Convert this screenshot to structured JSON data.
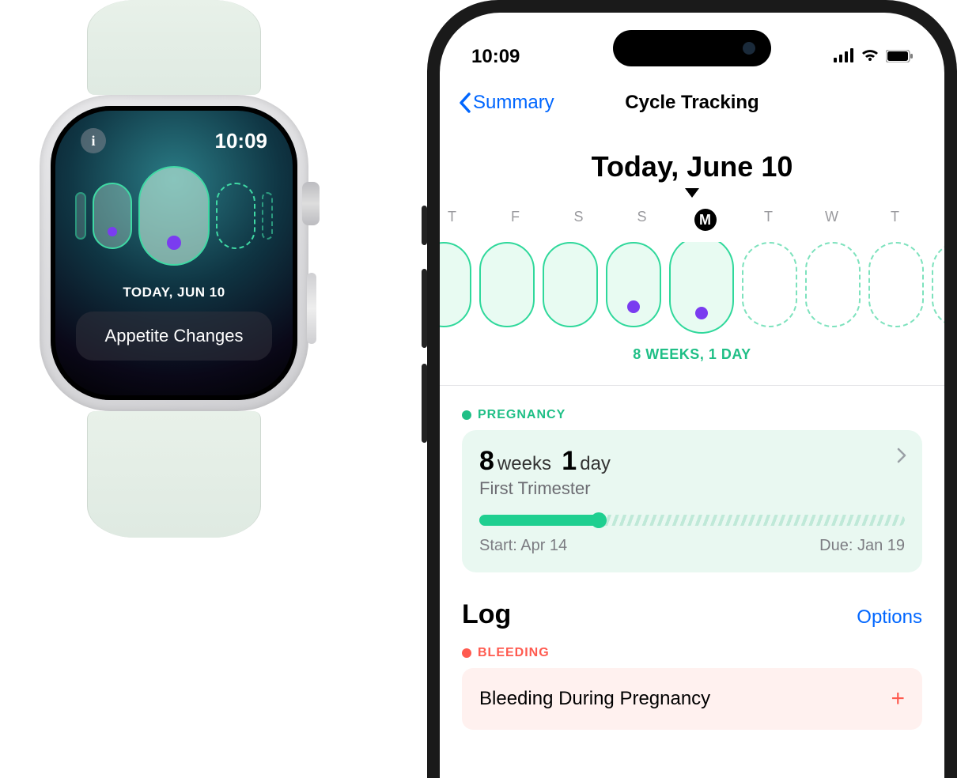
{
  "watch": {
    "time": "10:09",
    "date_label": "TODAY, JUN 10",
    "info_glyph": "i",
    "logged_item": "Appetite Changes"
  },
  "phone": {
    "status": {
      "time": "10:09"
    },
    "nav": {
      "back_label": "Summary",
      "title": "Cycle Tracking"
    },
    "today_heading": "Today, June 10",
    "day_letters": [
      "T",
      "F",
      "S",
      "S",
      "M",
      "T",
      "W",
      "T"
    ],
    "today_index": 4,
    "weeks_caption": "8 WEEKS, 1 DAY",
    "pregnancy": {
      "section_label": "PREGNANCY",
      "weeks_num": "8",
      "weeks_word": "weeks",
      "days_num": "1",
      "days_word": "day",
      "trimester": "First Trimester",
      "start_label": "Start: Apr 14",
      "due_label": "Due: Jan 19",
      "progress_pct": 28
    },
    "log": {
      "title": "Log",
      "options_label": "Options",
      "bleeding_label": "BLEEDING",
      "bleeding_item": "Bleeding During Pregnancy"
    }
  }
}
